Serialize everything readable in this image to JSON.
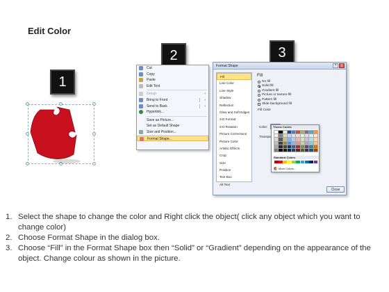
{
  "title": "Edit Color",
  "steps": [
    "1",
    "2",
    "3"
  ],
  "context_menu": {
    "items": [
      {
        "label": "Cut",
        "enabled": true
      },
      {
        "label": "Copy",
        "enabled": true
      },
      {
        "label": "Paste",
        "enabled": true
      },
      {
        "label": "Edit Text",
        "enabled": true
      },
      {
        "label": "Group",
        "enabled": false,
        "submenu": true
      },
      {
        "label": "Bring to Front",
        "enabled": true,
        "submenu": true,
        "split": true
      },
      {
        "label": "Send to Back",
        "enabled": true,
        "submenu": true,
        "split": true
      },
      {
        "label": "Hyperlink...",
        "enabled": true
      },
      {
        "label": "Save as Picture...",
        "enabled": true
      },
      {
        "label": "Set as Default Shape",
        "enabled": true
      },
      {
        "label": "Size and Position...",
        "enabled": true
      },
      {
        "label": "Format Shape...",
        "enabled": true,
        "highlighted": true
      }
    ]
  },
  "dialog": {
    "title": "Format Shape",
    "help": "?",
    "close": "X",
    "categories": [
      "Fill",
      "Line Color",
      "Line Style",
      "Shadow",
      "Reflection",
      "Glow and Soft Edges",
      "3-D Format",
      "3-D Rotation",
      "Picture Corrections",
      "Picture Color",
      "Artistic Effects",
      "Crop",
      "Size",
      "Position",
      "Text Box",
      "Alt Text"
    ],
    "selected_category": "Fill",
    "panel_heading": "Fill",
    "fill_options": [
      {
        "label": "No fill",
        "selected": false
      },
      {
        "label": "Solid fill",
        "selected": true
      },
      {
        "label": "Gradient fill",
        "selected": false
      },
      {
        "label": "Picture or texture fill",
        "selected": false
      },
      {
        "label": "Pattern fill",
        "selected": false
      }
    ],
    "slide_background_fill": "Slide background fill",
    "fill_color_label": "Fill Color",
    "color_label": "Color:",
    "transparency_label": "Transpar",
    "close_button": "Close"
  },
  "palette": {
    "theme_header": "Theme Colors",
    "standard_header": "Standard Colors",
    "more_colors": "More Colors...",
    "theme_colors": [
      [
        "#ffffff",
        "#000000",
        "#eeece1",
        "#1f497d",
        "#4f81bd",
        "#c0504d",
        "#9bbb59",
        "#8064a2",
        "#4bacc6",
        "#f79646"
      ],
      [
        "#f2f2f2",
        "#7f7f7f",
        "#ddd9c3",
        "#c6d9f0",
        "#dbe5f1",
        "#f2dcdb",
        "#ebf1dd",
        "#e5e0ec",
        "#dbeef3",
        "#fdeada"
      ],
      [
        "#d8d8d8",
        "#595959",
        "#c4bd97",
        "#8db3e2",
        "#b8cce4",
        "#e5b9b7",
        "#d7e3bc",
        "#ccc1d9",
        "#b7dde8",
        "#fbd5b5"
      ],
      [
        "#bfbfbf",
        "#3f3f3f",
        "#938953",
        "#548dd4",
        "#95b3d7",
        "#d99694",
        "#c3d69b",
        "#b2a2c7",
        "#92cddc",
        "#fac08f"
      ],
      [
        "#a5a5a5",
        "#262626",
        "#494429",
        "#17365d",
        "#366092",
        "#953734",
        "#76923c",
        "#5f497a",
        "#31859b",
        "#e36c09"
      ],
      [
        "#7f7f7f",
        "#0c0c0c",
        "#1d1b10",
        "#0f243e",
        "#244061",
        "#632423",
        "#4f6128",
        "#3f3151",
        "#205867",
        "#974806"
      ]
    ],
    "standard_colors": [
      "#c00000",
      "#ff0000",
      "#ffc000",
      "#ffff00",
      "#92d050",
      "#00b050",
      "#00b0f0",
      "#0070c0",
      "#002060",
      "#7030a0"
    ]
  },
  "shape": {
    "fill_color": "#c8101e"
  },
  "instructions": [
    {
      "num": "1.",
      "text": "Select the shape to change the color and Right click the object( click any object which you want to change color)"
    },
    {
      "num": "2.",
      "text": "Choose Format Shape in the dialog box."
    },
    {
      "num": "3.",
      "text": "Choose “Fill” in the Format Shape box then “Solid” or “Gradient” depending on the appearance of the object. Change colour as shown in the picture."
    }
  ]
}
